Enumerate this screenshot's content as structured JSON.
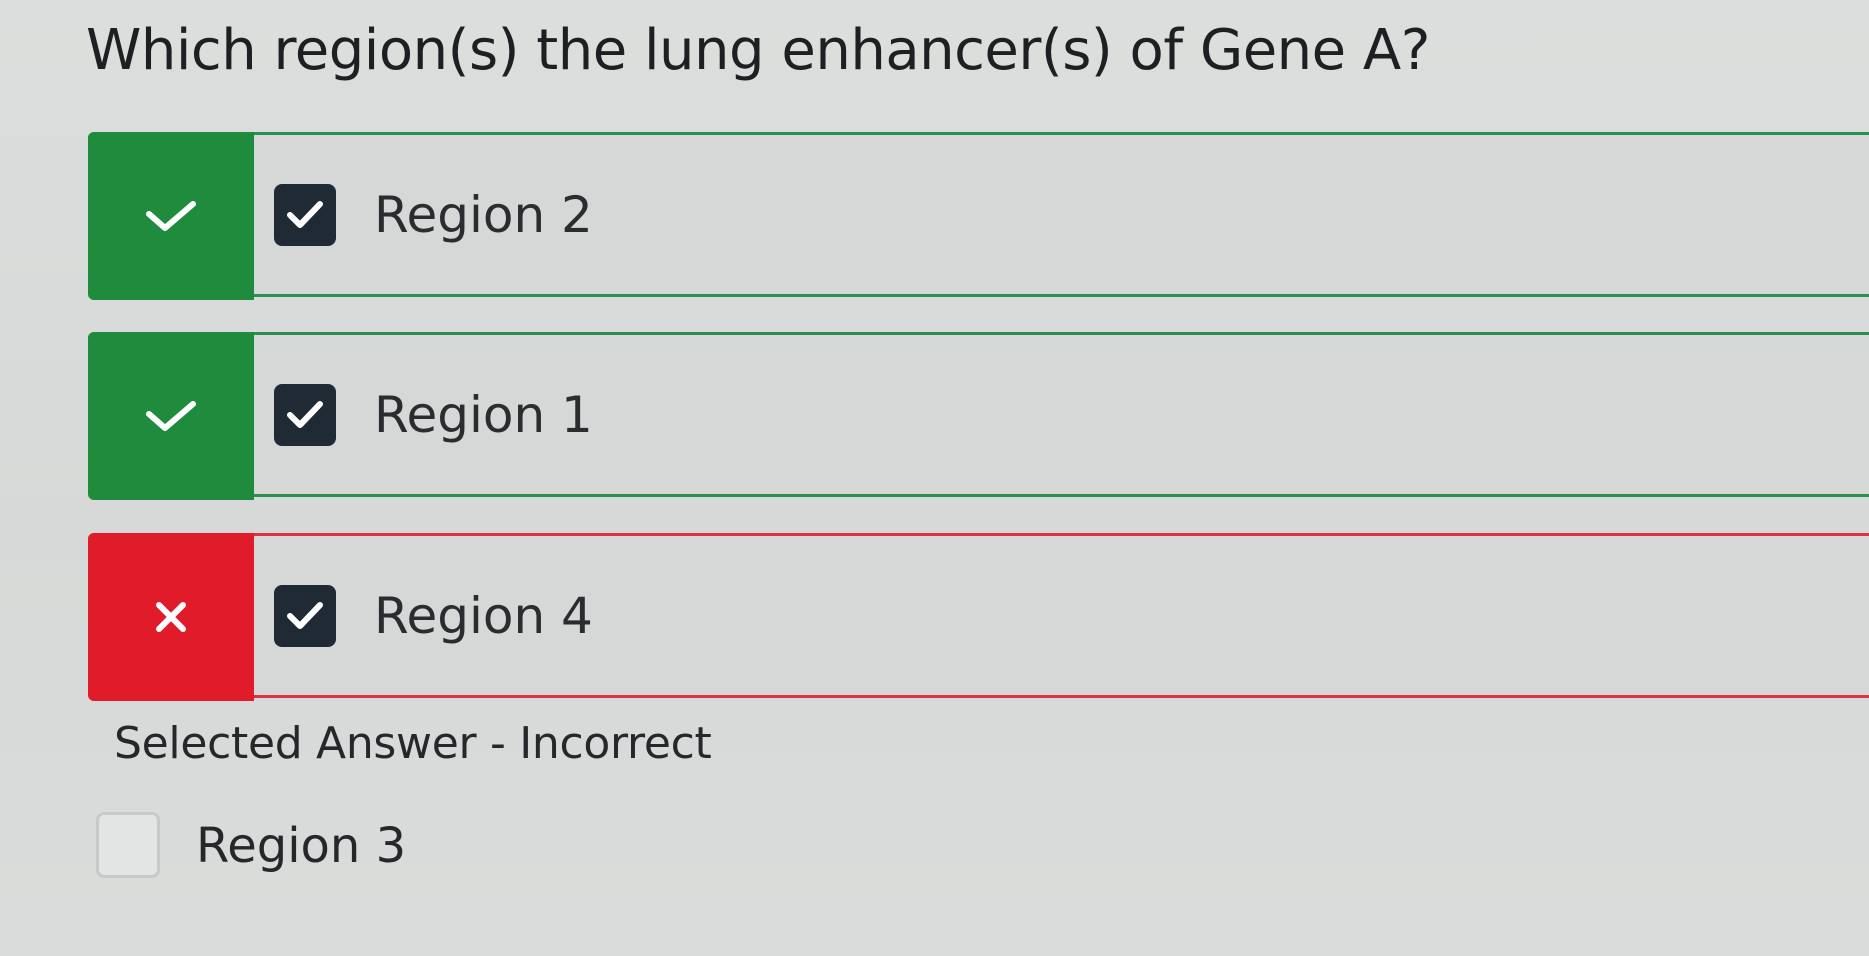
{
  "question": {
    "text": "Which region(s) the lung enhancer(s) of Gene A?"
  },
  "answers": [
    {
      "label": "Region 2",
      "status": "correct",
      "status_icon": "check-icon",
      "checked": true
    },
    {
      "label": "Region 1",
      "status": "correct",
      "status_icon": "check-icon",
      "checked": true
    },
    {
      "label": "Region 4",
      "status": "incorrect",
      "status_icon": "x-icon",
      "checked": true
    }
  ],
  "feedback": {
    "text": "Selected Answer - Incorrect"
  },
  "unselected_options": [
    {
      "label": "Region 3",
      "checked": false
    }
  ],
  "colors": {
    "correct": "#1e8c3c",
    "incorrect": "#e01c2a",
    "checkbox_dark": "#1f2a35"
  }
}
